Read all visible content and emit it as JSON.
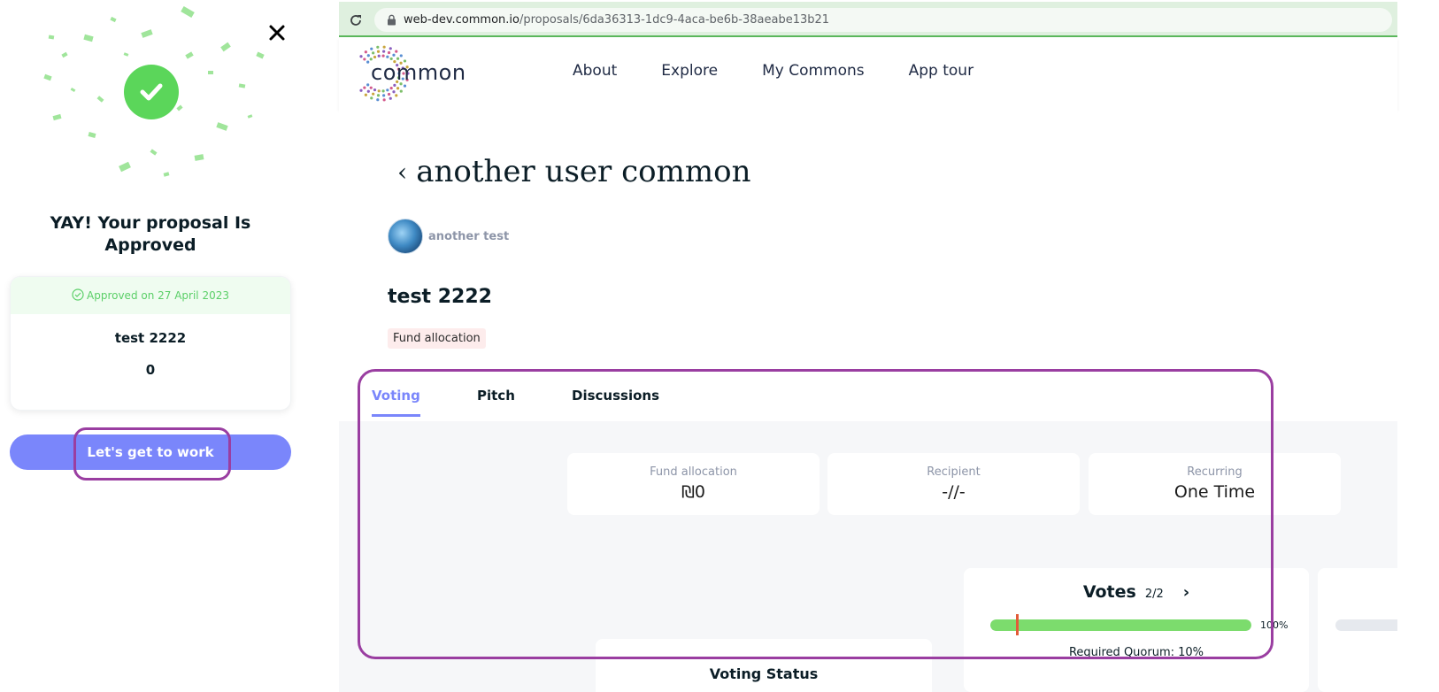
{
  "modal": {
    "title": "YAY! Your proposal Is Approved",
    "approval_banner": "Approved on 27 April 2023",
    "proposal_name": "test 2222",
    "amount": "0",
    "cta_label": "Let's get to work",
    "success_color": "#5bd65a",
    "cta_color": "#7a86fb",
    "icons": {
      "close": "close-icon",
      "check": "check-icon",
      "banner": "check-circle-icon"
    }
  },
  "browser": {
    "url_host": "web-dev.common.io",
    "url_path": "/proposals/6da36313-1dc9-4aca-be6b-38aeabe13b21",
    "icons": {
      "reload": "reload-icon",
      "lock": "lock-icon"
    }
  },
  "header": {
    "logo_text": "common",
    "nav": [
      {
        "label": "About"
      },
      {
        "label": "Explore"
      },
      {
        "label": "My Commons"
      },
      {
        "label": "App tour"
      }
    ]
  },
  "proposal": {
    "common_name": "another user common",
    "author": "another test",
    "title": "test 2222",
    "tag": "Fund allocation",
    "tabs": [
      {
        "label": "Voting",
        "active": true
      },
      {
        "label": "Pitch",
        "active": false
      },
      {
        "label": "Discussions",
        "active": false
      }
    ],
    "info_cards": [
      {
        "label": "Fund allocation",
        "value": "₪0"
      },
      {
        "label": "Recipient",
        "value": "-//-"
      },
      {
        "label": "Recurring",
        "value": "One Time"
      }
    ],
    "votes": {
      "label": "Votes",
      "count": "2/2",
      "percent_label": "100%",
      "progress": 1.0,
      "quorum_fraction": 0.1,
      "quorum_label": "Required Quorum: 10%"
    },
    "voting_status_title": "Voting Status"
  },
  "accents": {
    "highlight": "#9a3ea1",
    "tab_active": "#7a86fb"
  }
}
